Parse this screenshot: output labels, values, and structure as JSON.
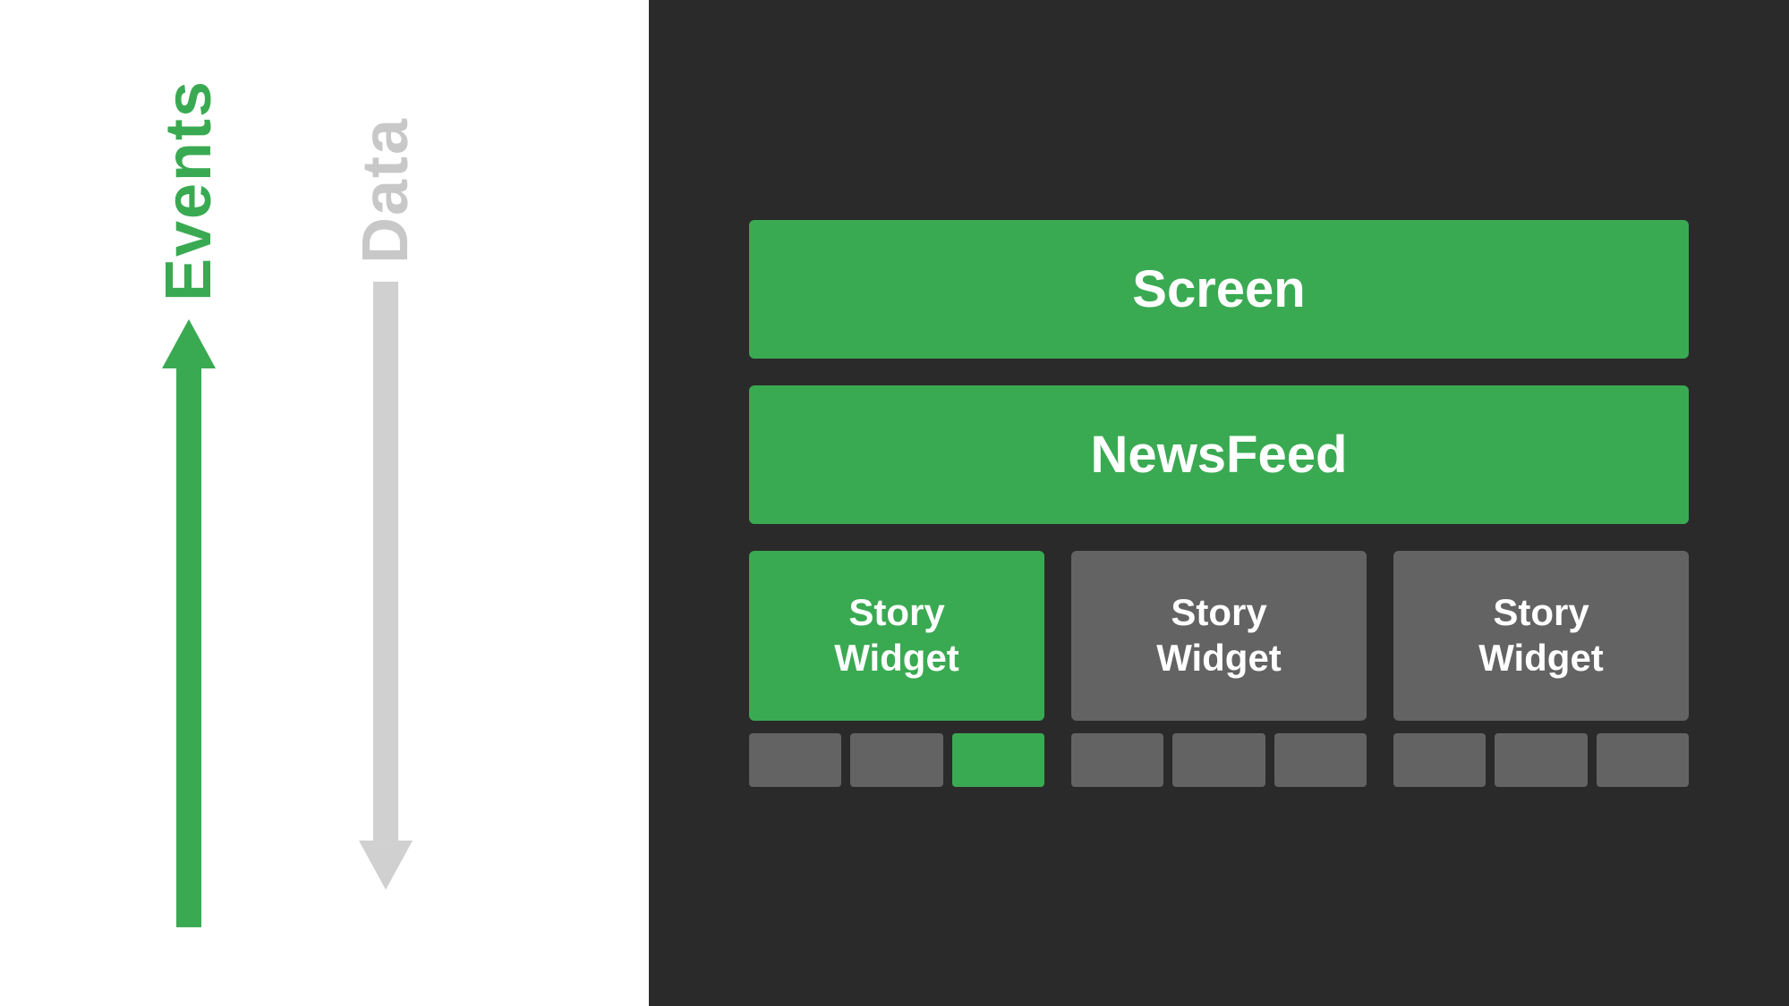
{
  "left": {
    "events_label": "Events",
    "data_label": "Data"
  },
  "right": {
    "screen_label": "Screen",
    "newsfeed_label": "NewsFeed",
    "story_widget_label": "Story\nWidget",
    "widgets": [
      {
        "id": "widget-1",
        "color": "green",
        "sub_boxes": [
          "gray",
          "gray",
          "green"
        ]
      },
      {
        "id": "widget-2",
        "color": "gray",
        "sub_boxes": [
          "gray",
          "gray",
          "gray"
        ]
      },
      {
        "id": "widget-3",
        "color": "gray",
        "sub_boxes": [
          "gray",
          "gray",
          "gray"
        ]
      }
    ]
  }
}
